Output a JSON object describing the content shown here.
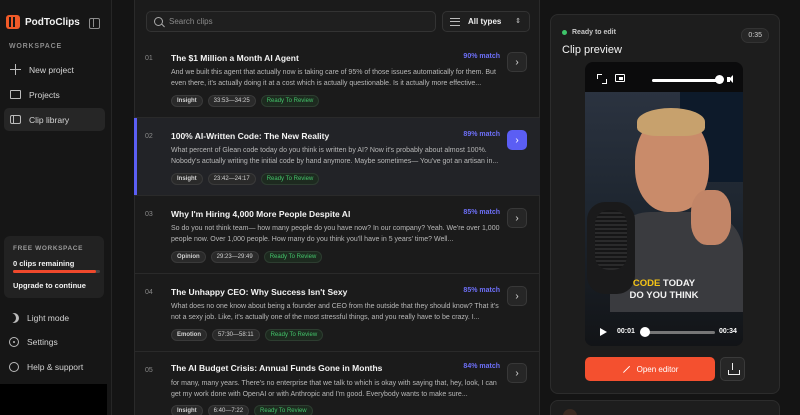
{
  "app": {
    "name": "PodToClips"
  },
  "sidebar": {
    "section_label": "WORKSPACE",
    "items": [
      {
        "label": "New project",
        "icon": "plus-icon"
      },
      {
        "label": "Projects",
        "icon": "folder-icon"
      },
      {
        "label": "Clip library",
        "icon": "clip-icon",
        "active": true
      }
    ],
    "workspace_card": {
      "title": "FREE WORKSPACE",
      "count": "0 clips remaining",
      "usage_fraction": 0.95,
      "upgrade": "Upgrade to continue"
    },
    "footer": [
      {
        "label": "Light mode",
        "icon": "moon-icon"
      },
      {
        "label": "Settings",
        "icon": "gear-icon"
      },
      {
        "label": "Help & support",
        "icon": "help-icon"
      }
    ]
  },
  "toolbar": {
    "search_placeholder": "Search clips",
    "type_filter": "All types"
  },
  "clips": [
    {
      "num": "01",
      "title": "The $1 Million a Month AI Agent",
      "match": "90% match",
      "text": "And we built this agent that actually now is taking care of 95% of those issues automatically for them. But even there, it's actually doing it at a cost which is actually questionable. Is it actually more effective...",
      "category": "Insight",
      "time": "33:53—34:25",
      "status": "Ready To Review"
    },
    {
      "num": "02",
      "title": "100% AI-Written Code: The New Reality",
      "match": "89% match",
      "text": "What percent of Glean code today do you think is written by AI? Now it's probably about almost 100%. Nobody's actually writing the initial code by hand anymore. Maybe sometimes— You've got an artisan in...",
      "category": "Insight",
      "time": "23:42—24:17",
      "status": "Ready To Review",
      "selected": true
    },
    {
      "num": "03",
      "title": "Why I'm Hiring 4,000 More People Despite AI",
      "match": "85% match",
      "text": "So do you not think team— how many people do you have now? In our company? Yeah. We're over 1,000 people now. Over 1,000 people. How many do you think you'll have in 5 years' time? Well...",
      "category": "Opinion",
      "time": "29:23—29:49",
      "status": "Ready To Review"
    },
    {
      "num": "04",
      "title": "The Unhappy CEO: Why Success Isn't Sexy",
      "match": "85% match",
      "text": "What does no one know about being a founder and CEO from the outside that they should know? That it's not a sexy job. Like, it's actually one of the most stressful things, and you really have to be crazy. I...",
      "category": "Emotion",
      "time": "57:30—58:11",
      "status": "Ready To Review"
    },
    {
      "num": "05",
      "title": "The AI Budget Crisis: Annual Funds Gone in Months",
      "match": "84% match",
      "text": "for many, many years. There's no enterprise that we talk to which is okay with saying that, hey, look, I can get my work done with OpenAI or with Anthropic and I'm good. Everybody wants to make sure...",
      "category": "Insight",
      "time": "6:40—7:22",
      "status": "Ready To Review"
    }
  ],
  "preview": {
    "status": "Ready to edit",
    "title": "Clip preview",
    "duration": "0:35",
    "caption_line1_highlight": "CODE",
    "caption_line1_rest": " TODAY",
    "caption_line2": "DO YOU THINK",
    "current_time": "00:01",
    "end_time": "00:34",
    "volume_fraction": 0.9,
    "progress_fraction": 0.03,
    "open_editor": "Open editor"
  },
  "colors": {
    "accent": "#5b5ef4",
    "brand": "#f4502f",
    "status_green": "#43c46a",
    "caption_highlight": "#f5c416"
  }
}
